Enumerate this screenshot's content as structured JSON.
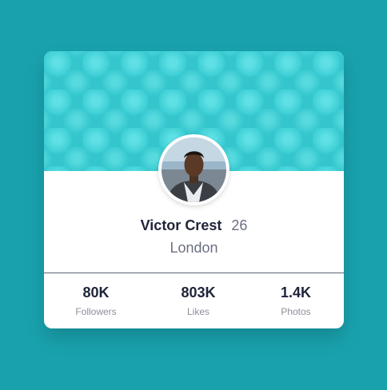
{
  "profile": {
    "name": "Victor Crest",
    "age": "26",
    "city": "London"
  },
  "stats": [
    {
      "value": "80K",
      "label": "Followers"
    },
    {
      "value": "803K",
      "label": "Likes"
    },
    {
      "value": "1.4K",
      "label": "Photos"
    }
  ],
  "colors": {
    "page_background": "#19a2ae",
    "banner": "#34c5cd",
    "text_primary": "#1f2438",
    "text_secondary": "#6b7080"
  }
}
